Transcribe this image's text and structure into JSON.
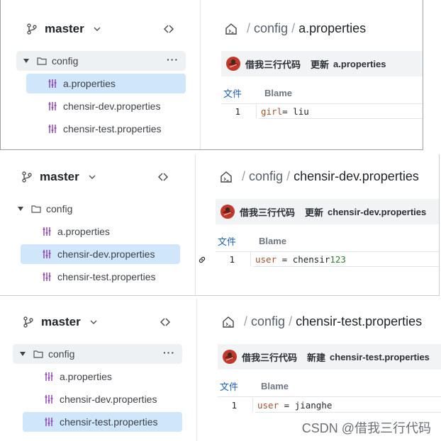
{
  "panels": [
    {
      "branch": "master",
      "folder": "config",
      "files": [
        "a.properties",
        "chensir-dev.properties",
        "chensir-test.properties"
      ],
      "selected_index": 0,
      "breadcrumb": {
        "root": "config",
        "file": "a.properties"
      },
      "commit": {
        "author": "借我三行代码",
        "action": "更新",
        "file": "a.properties"
      },
      "tabs": {
        "file": "文件",
        "blame": "Blame"
      },
      "line_number": "1",
      "code": {
        "key": "girl",
        "op": "= ",
        "value": "liu",
        "num": ""
      }
    },
    {
      "branch": "master",
      "folder": "config",
      "files": [
        "a.properties",
        "chensir-dev.properties",
        "chensir-test.properties"
      ],
      "selected_index": 1,
      "breadcrumb": {
        "root": "config",
        "file": "chensir-dev.properties"
      },
      "commit": {
        "author": "借我三行代码",
        "action": "更新",
        "file": "chensir-dev.properties"
      },
      "tabs": {
        "file": "文件",
        "blame": "Blame"
      },
      "line_number": "1",
      "code": {
        "key": "user",
        "op": " = ",
        "value": "chensir",
        "num": "123"
      }
    },
    {
      "branch": "master",
      "folder": "config",
      "files": [
        "a.properties",
        "chensir-dev.properties",
        "chensir-test.properties"
      ],
      "selected_index": 2,
      "breadcrumb": {
        "root": "config",
        "file": "chensir-test.properties"
      },
      "commit": {
        "author": "借我三行代码",
        "action": "新建",
        "file": "chensir-test.properties"
      },
      "tabs": {
        "file": "文件",
        "blame": "Blame"
      },
      "line_number": "1",
      "code": {
        "key": "user",
        "op": " = ",
        "value": "jianghe",
        "num": ""
      }
    }
  ],
  "more_menu": "···",
  "watermark": "CSDN @借我三行代码",
  "colors": {
    "selected_bg": "#cfe6fb",
    "commit_bg": "#f2f3f5",
    "file_icon": "#8a3fb3",
    "tab_active": "#1a5fb4"
  }
}
